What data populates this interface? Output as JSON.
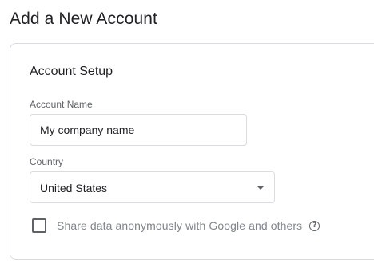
{
  "page": {
    "title": "Add a New Account"
  },
  "account_setup": {
    "title": "Account Setup",
    "account_name": {
      "label": "Account Name",
      "value": "My company name"
    },
    "country": {
      "label": "Country",
      "selected": "United States"
    },
    "share_data": {
      "label": "Share data anonymously with Google and others",
      "checked": false,
      "help_icon": "help-icon"
    }
  },
  "colors": {
    "border": "#dadce0",
    "text_primary": "#202124",
    "text_secondary": "#5f6368",
    "text_muted": "#80868b"
  }
}
